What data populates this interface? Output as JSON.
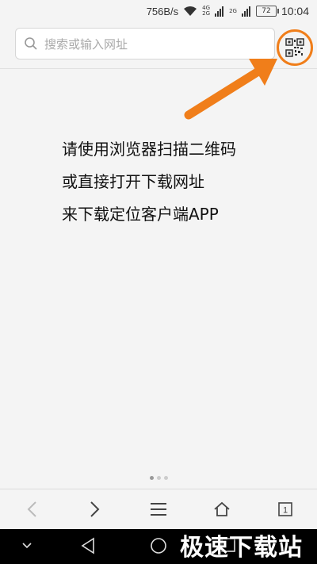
{
  "status": {
    "net_speed": "756B/s",
    "signal1_top": "4G",
    "signal1_bottom": "2G",
    "signal2_top": "2G",
    "battery": "72",
    "time": "10:04"
  },
  "search": {
    "placeholder": "搜索或输入网址"
  },
  "instructions": {
    "line1": "请使用浏览器扫描二维码",
    "line2": "或直接打开下载网址",
    "line3": "来下载定位客户端APP"
  },
  "tab_count": "1",
  "watermark": "极速下载站",
  "colors": {
    "accent": "#f07e1a",
    "background": "#f4f4f4"
  },
  "icons": {
    "qr": "qr-code-icon",
    "back": "chevron-left-icon",
    "forward": "chevron-right-icon",
    "menu": "menu-icon",
    "home": "home-icon",
    "tabs": "tabs-icon"
  }
}
